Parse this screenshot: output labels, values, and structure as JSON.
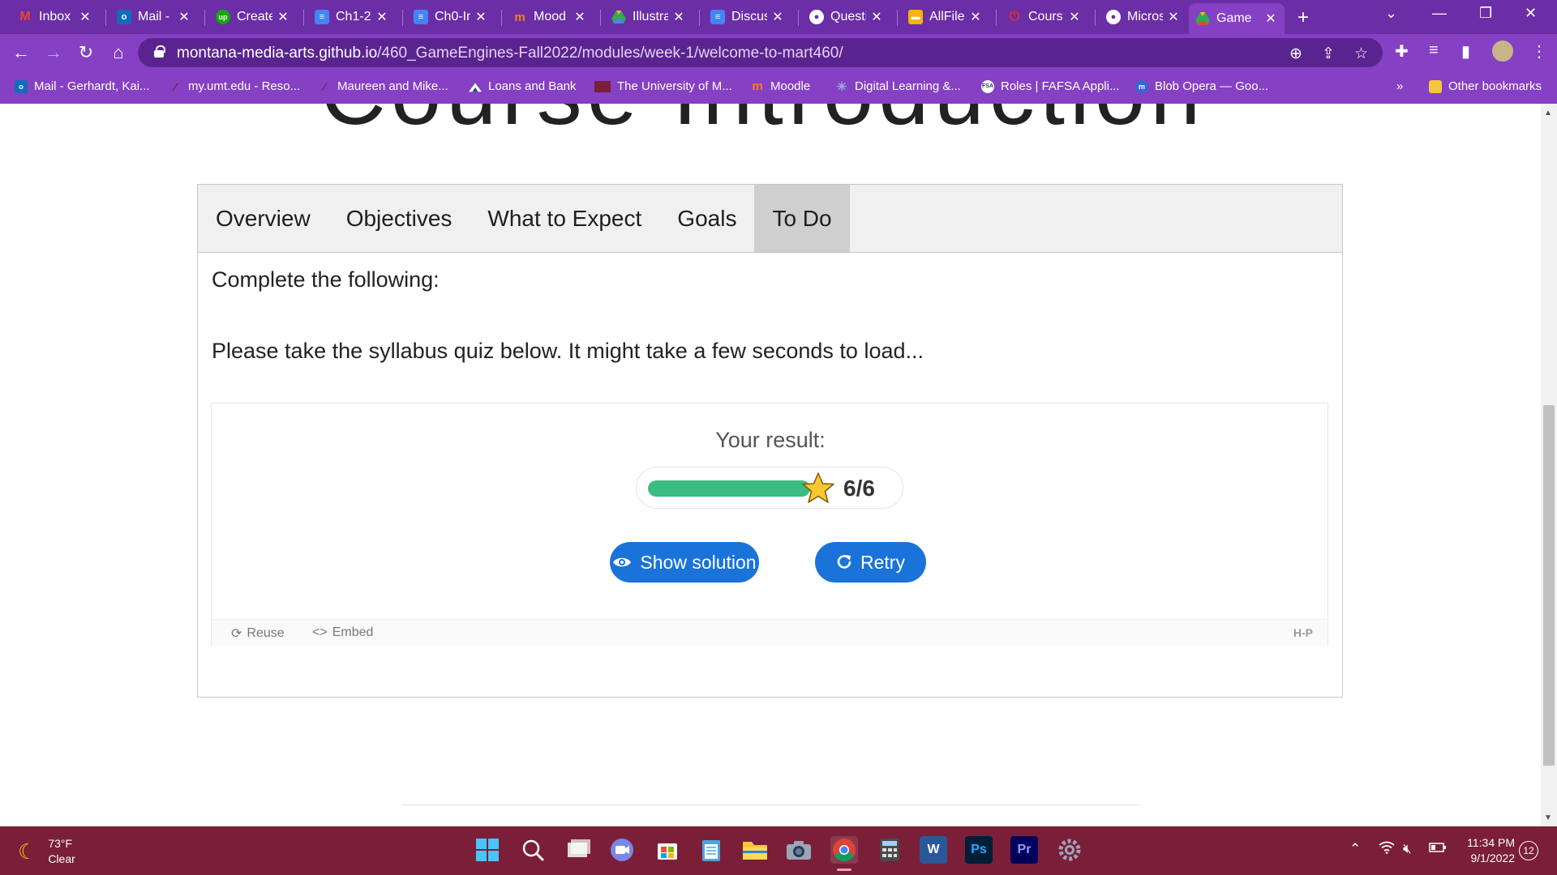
{
  "browser": {
    "tabs": [
      {
        "label": "Inbox",
        "icon": "gmail-icon",
        "color": "#ea4335"
      },
      {
        "label": "Mail -",
        "icon": "outlook-icon",
        "color": "#0f6cbd"
      },
      {
        "label": "Create",
        "icon": "upwork-icon",
        "color": "#14a800"
      },
      {
        "label": "Ch1-2",
        "icon": "docs-icon",
        "color": "#4285f4"
      },
      {
        "label": "Ch0-In",
        "icon": "docs-icon",
        "color": "#4285f4"
      },
      {
        "label": "Mood",
        "icon": "moodle-icon",
        "color": "#f98012"
      },
      {
        "label": "Illustra",
        "icon": "drive-icon",
        "color": "#34a853"
      },
      {
        "label": "Discus",
        "icon": "docs-icon",
        "color": "#4285f4"
      },
      {
        "label": "Questi",
        "icon": "globe-icon",
        "color": "#ffffff"
      },
      {
        "label": "AllFile",
        "icon": "folder-icon",
        "color": "#f4b400"
      },
      {
        "label": "Cours",
        "icon": "power-icon",
        "color": "#d93025"
      },
      {
        "label": "Micros",
        "icon": "globe-icon",
        "color": "#ffffff"
      },
      {
        "label": "Game",
        "icon": "drive-icon",
        "color": "#34a853",
        "active": true
      }
    ],
    "new_tab": "+",
    "url_host": "montana-media-arts.github.io",
    "url_path": "/460_GameEngines-Fall2022/modules/week-1/welcome-to-mart460/",
    "bookmarks": [
      {
        "label": "Mail - Gerhardt, Kai...",
        "icon": "outlook-icon"
      },
      {
        "label": "my.umt.edu - Reso...",
        "icon": "umt-icon"
      },
      {
        "label": "Maureen and Mike...",
        "icon": "umt-icon"
      },
      {
        "label": "Loans and Bank",
        "icon": "mountain-icon"
      },
      {
        "label": "The University of M...",
        "icon": "umt-flag-icon"
      },
      {
        "label": "Moodle",
        "icon": "moodle-icon"
      },
      {
        "label": "Digital Learning &...",
        "icon": "sparkle-icon"
      },
      {
        "label": "Roles | FAFSA Appli...",
        "icon": "fsa-icon"
      },
      {
        "label": "Blob Opera — Goo...",
        "icon": "arts-icon"
      }
    ],
    "bookmarks_overflow": "»",
    "other_bookmarks": "Other bookmarks"
  },
  "page": {
    "heading": "Course Introduction",
    "tabs": [
      "Overview",
      "Objectives",
      "What to Expect",
      "Goals",
      "To Do"
    ],
    "active_tab": "To Do",
    "complete_text": "Complete the following:",
    "instructions": "Please take the syllabus quiz below. It might take a few seconds to load...",
    "quiz": {
      "result_label": "Your result:",
      "score_text": "6/6",
      "score_fraction": 1.0,
      "show_solution_label": "Show solution",
      "retry_label": "Retry",
      "reuse_label": "Reuse",
      "embed_label": "Embed",
      "h5p_logo": "H-P"
    }
  },
  "taskbar": {
    "temperature": "73°F",
    "condition": "Clear",
    "time": "11:34 PM",
    "date": "9/1/2022",
    "notifications": "12",
    "apps": [
      "windows-start",
      "search",
      "task-view",
      "zoom",
      "microsoft-store",
      "notepad",
      "file-explorer",
      "camera",
      "chrome",
      "calculator",
      "word",
      "photoshop",
      "premiere",
      "settings"
    ]
  },
  "colors": {
    "browser_frame": "#6b2ea6",
    "toolbar": "#8540c4",
    "button_blue": "#1a73d9",
    "progress_green": "#3bbd82",
    "taskbar": "#7a1f37"
  }
}
